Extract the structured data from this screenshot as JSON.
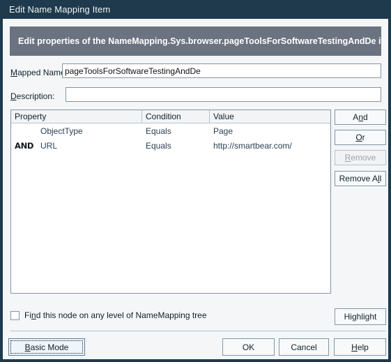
{
  "window": {
    "title": "Edit Name Mapping Item"
  },
  "banner": {
    "text": "Edit properties of the NameMapping.Sys.browser.pageToolsForSoftwareTestingAndDe item"
  },
  "form": {
    "mapped_name": {
      "label_pre": "M",
      "label_post": "apped Name:",
      "value": "pageToolsForSoftwareTestingAndDe",
      "placeholder": ""
    },
    "description": {
      "label_pre": "D",
      "label_post": "escription:",
      "value": "",
      "placeholder": ""
    }
  },
  "conditions_table": {
    "columns": [
      "Property",
      "Condition",
      "Value"
    ],
    "rows": [
      {
        "operator": "",
        "property": "ObjectType",
        "condition": "Equals",
        "value": "Page"
      },
      {
        "operator": "AND",
        "property": "URL",
        "condition": "Equals",
        "value": "http://smartbear.com/"
      }
    ]
  },
  "side_buttons": {
    "and": {
      "pre": "A",
      "acc": "n",
      "post": "d",
      "enabled": true
    },
    "or": {
      "pre": "",
      "acc": "O",
      "post": "r",
      "enabled": true
    },
    "remove": {
      "pre": "",
      "acc": "R",
      "post": "emove",
      "enabled": false
    },
    "remove_all": {
      "pre": "Remove A",
      "acc": "l",
      "post": "l",
      "enabled": true
    }
  },
  "find_option": {
    "checked": false,
    "label_pre": "Fi",
    "label_acc": "n",
    "label_post": "d this node on any level of NameMapping tree"
  },
  "highlight_button": {
    "pre": "Hi",
    "acc": "g",
    "post": "hlight"
  },
  "bottom_buttons": {
    "basic_mode": {
      "pre": "",
      "acc": "B",
      "post": "asic Mode",
      "focused": true
    },
    "ok": {
      "pre": "OK",
      "acc": "",
      "post": ""
    },
    "cancel": {
      "pre": "Cancel",
      "acc": "",
      "post": ""
    },
    "help": {
      "pre": "",
      "acc": "H",
      "post": "elp"
    }
  },
  "colors": {
    "titlebar": "#1e3a4c",
    "banner": "#6b7280",
    "dialog_background": "#f4f6f8",
    "field_border": "#8295a8",
    "text": "#12202b",
    "row_text": "#2c3f50",
    "disabled_text": "#9aa6b2"
  }
}
